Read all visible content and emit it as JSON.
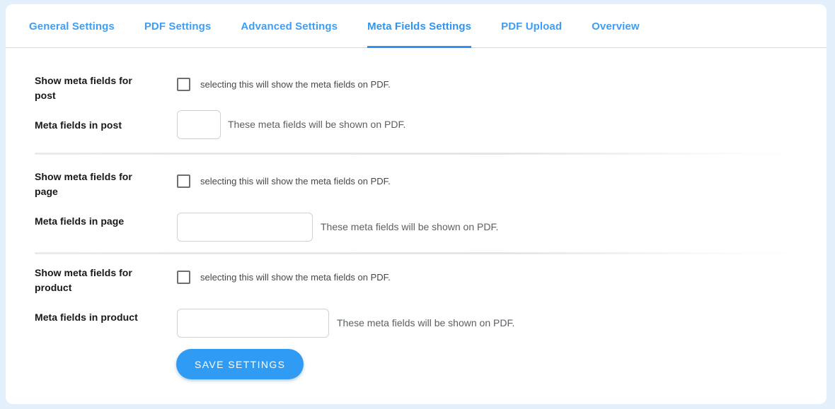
{
  "theme": {
    "page_background": "#e3f0fb",
    "card_background": "#ffffff",
    "accent": "#2f9bf2",
    "tab_link": "#3d9ef5",
    "label_color": "#17181a",
    "hint_color": "#5b6064",
    "input_border": "#cfd2d4",
    "checkbox_border": "#6d6f72"
  },
  "tabs": [
    {
      "label": "General Settings",
      "active": false
    },
    {
      "label": "PDF Settings",
      "active": false
    },
    {
      "label": "Advanced Settings",
      "active": false
    },
    {
      "label": "Meta Fields Settings",
      "active": true
    },
    {
      "label": "PDF Upload",
      "active": false
    },
    {
      "label": "Overview",
      "active": false
    }
  ],
  "sections": [
    {
      "toggle_label": "Show meta fields for post",
      "toggle_hint": "selecting this will show the meta fields on PDF.",
      "checkbox_checked": false,
      "field_label": "Meta fields in post",
      "field_value": "",
      "field_placeholder": "",
      "field_hint": "These meta fields will be shown on PDF."
    },
    {
      "toggle_label": "Show meta fields for page",
      "toggle_hint": "selecting this will show the meta fields on PDF.",
      "checkbox_checked": false,
      "field_label": "Meta fields in page",
      "field_value": "",
      "field_placeholder": "",
      "field_hint": "These meta fields will be shown on PDF."
    },
    {
      "toggle_label": "Show meta fields for product",
      "toggle_hint": "selecting this will show the meta fields on PDF.",
      "checkbox_checked": false,
      "field_label": "Meta fields in product",
      "field_value": "",
      "field_placeholder": "",
      "field_hint": "These meta fields will be shown on PDF."
    }
  ],
  "save_button": {
    "label": "SAVE SETTINGS"
  }
}
